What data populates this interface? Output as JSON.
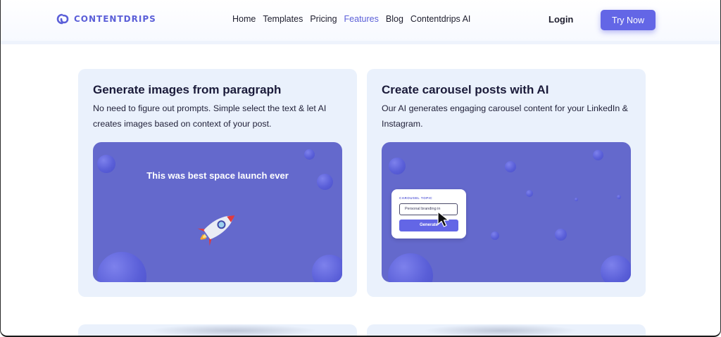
{
  "brand": {
    "name": "CONTENTDRIPS",
    "color": "#5b5fd8"
  },
  "nav": {
    "items": [
      {
        "label": "Home",
        "active": false
      },
      {
        "label": "Templates",
        "active": false
      },
      {
        "label": "Pricing",
        "active": false
      },
      {
        "label": "Features",
        "active": true
      },
      {
        "label": "Blog",
        "active": false
      },
      {
        "label": "Contentdrips AI",
        "active": false
      }
    ]
  },
  "header": {
    "login_label": "Login",
    "cta_label": "Try Now"
  },
  "cards": {
    "paragraph": {
      "title": "Generate images from paragraph",
      "description": "No need to figure out prompts. Simple select the text & let AI creates images based on context of your post.",
      "visual_text": "This was best space launch ever",
      "icon": "rocket-icon"
    },
    "carousel": {
      "title": "Create carousel posts with AI",
      "description": "Our AI generates engaging carousel content for your LinkedIn & Instagram.",
      "form_label": "CAROUSEL TOPIC",
      "input_value": "Personal branding in",
      "button_label": "Generate",
      "icon": "mouse-pointer-icon"
    }
  },
  "colors": {
    "accent": "#6366e6",
    "card_bg": "#eaf1fc",
    "visual_bg": "#6469cc"
  }
}
